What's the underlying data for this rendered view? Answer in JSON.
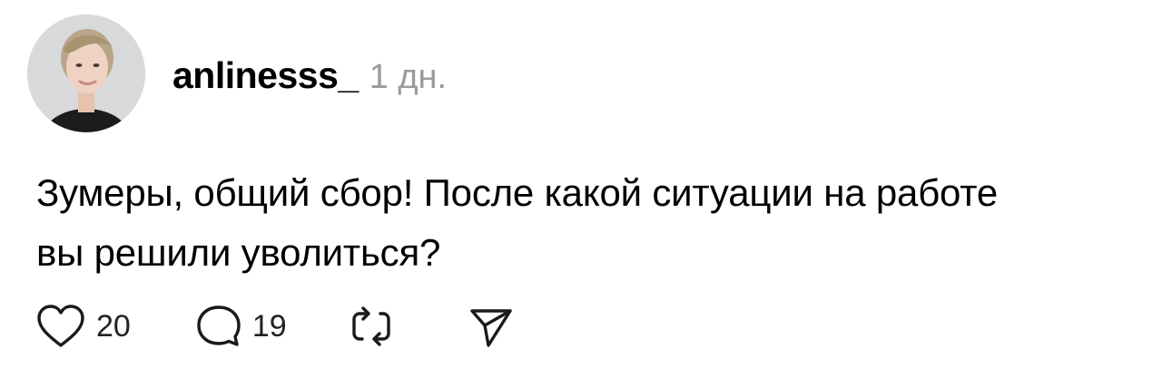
{
  "post": {
    "author": "anlinesss_",
    "time": "1 дн.",
    "text_line1": "Зумеры, общий сбор! После какой ситуации на работе",
    "text_line2": "вы решили уволиться?",
    "likes": "20",
    "comments": "19"
  },
  "icons": {
    "like": "heart-icon",
    "comment": "comment-bubble-icon",
    "repost": "repost-icon",
    "share": "send-icon"
  },
  "colors": {
    "text": "#000000",
    "muted": "#9a9a9a",
    "icon": "#1a1a1a"
  }
}
